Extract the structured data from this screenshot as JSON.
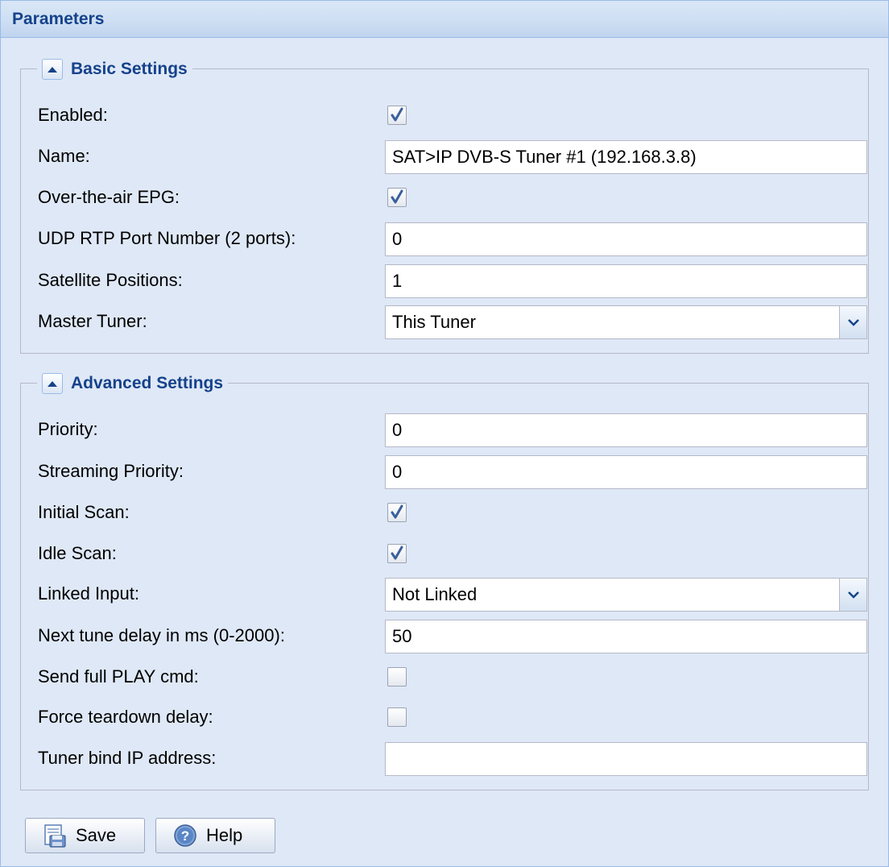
{
  "panel": {
    "title": "Parameters"
  },
  "basic": {
    "legend": "Basic Settings",
    "enabled": {
      "label": "Enabled:",
      "checked": true
    },
    "name": {
      "label": "Name:",
      "value": "SAT>IP DVB-S Tuner #1 (192.168.3.8)"
    },
    "ota_epg": {
      "label": "Over-the-air EPG:",
      "checked": true
    },
    "udp_port": {
      "label": "UDP RTP Port Number (2 ports):",
      "value": "0"
    },
    "sat_positions": {
      "label": "Satellite Positions:",
      "value": "1"
    },
    "master_tuner": {
      "label": "Master Tuner:",
      "value": "This Tuner"
    }
  },
  "advanced": {
    "legend": "Advanced Settings",
    "priority": {
      "label": "Priority:",
      "value": "0"
    },
    "streaming_priority": {
      "label": "Streaming Priority:",
      "value": "0"
    },
    "initial_scan": {
      "label": "Initial Scan:",
      "checked": true
    },
    "idle_scan": {
      "label": "Idle Scan:",
      "checked": true
    },
    "linked_input": {
      "label": "Linked Input:",
      "value": "Not Linked"
    },
    "tune_delay": {
      "label": "Next tune delay in ms (0-2000):",
      "value": "50"
    },
    "full_play": {
      "label": "Send full PLAY cmd:",
      "checked": false
    },
    "teardown_delay": {
      "label": "Force teardown delay:",
      "checked": false
    },
    "bind_ip": {
      "label": "Tuner bind IP address:",
      "value": ""
    }
  },
  "buttons": {
    "save": "Save",
    "help": "Help"
  },
  "icons": {
    "save": "save-disk-icon",
    "help": "help-question-icon",
    "collapse": "collapse-up-icon",
    "dropdown": "chevron-down-icon",
    "check": "checkmark-icon"
  },
  "colors": {
    "header_text": "#15428b",
    "panel_bg": "#dfe8f6",
    "border": "#99bbe8"
  }
}
